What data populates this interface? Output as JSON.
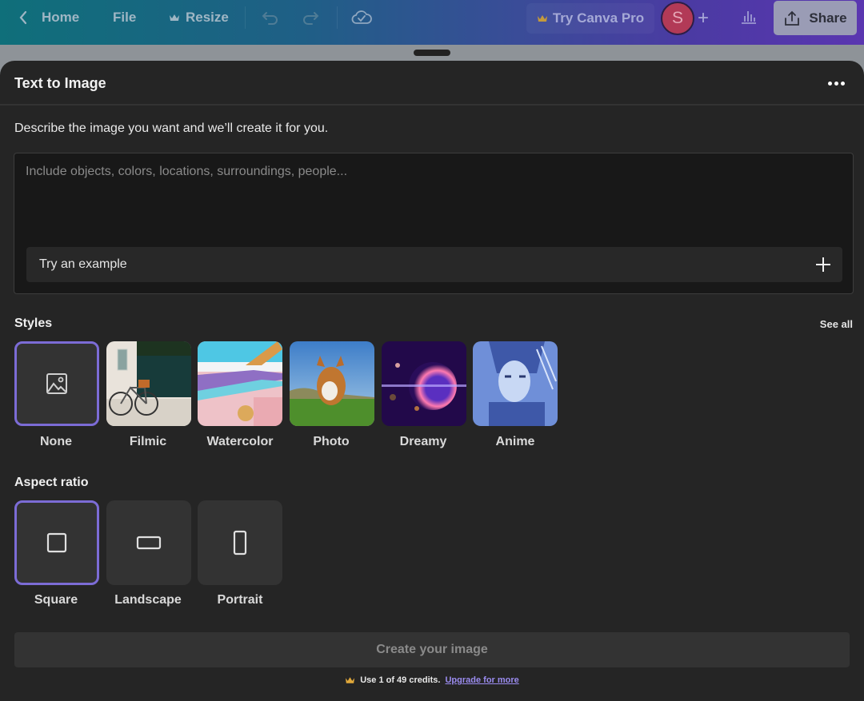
{
  "topbar": {
    "home_label": "Home",
    "file_label": "File",
    "resize_label": "Resize",
    "try_pro_label": "Try Canva Pro",
    "avatar_initial": "S",
    "share_label": "Share"
  },
  "panel": {
    "title": "Text to Image",
    "description": "Describe the image you want and we’ll create it for you.",
    "prompt": {
      "value": "",
      "placeholder": "Include objects, colors, locations, surroundings, people..."
    },
    "try_example_label": "Try an example"
  },
  "styles": {
    "heading": "Styles",
    "see_all_label": "See all",
    "selected": "None",
    "items": [
      {
        "label": "None"
      },
      {
        "label": "Filmic"
      },
      {
        "label": "Watercolor"
      },
      {
        "label": "Photo"
      },
      {
        "label": "Dreamy"
      },
      {
        "label": "Anime"
      }
    ]
  },
  "aspect_ratio": {
    "heading": "Aspect ratio",
    "selected": "Square",
    "items": [
      {
        "label": "Square"
      },
      {
        "label": "Landscape"
      },
      {
        "label": "Portrait"
      }
    ]
  },
  "footer": {
    "create_label": "Create your image",
    "credits_text": "Use 1 of 49 credits.",
    "upgrade_link": "Upgrade for more"
  },
  "colors": {
    "accent_selected": "#7c6cd6",
    "panel_bg": "#252525",
    "link": "#9b8cf0",
    "avatar": "#b23a57",
    "crown": "#e2a93a"
  }
}
